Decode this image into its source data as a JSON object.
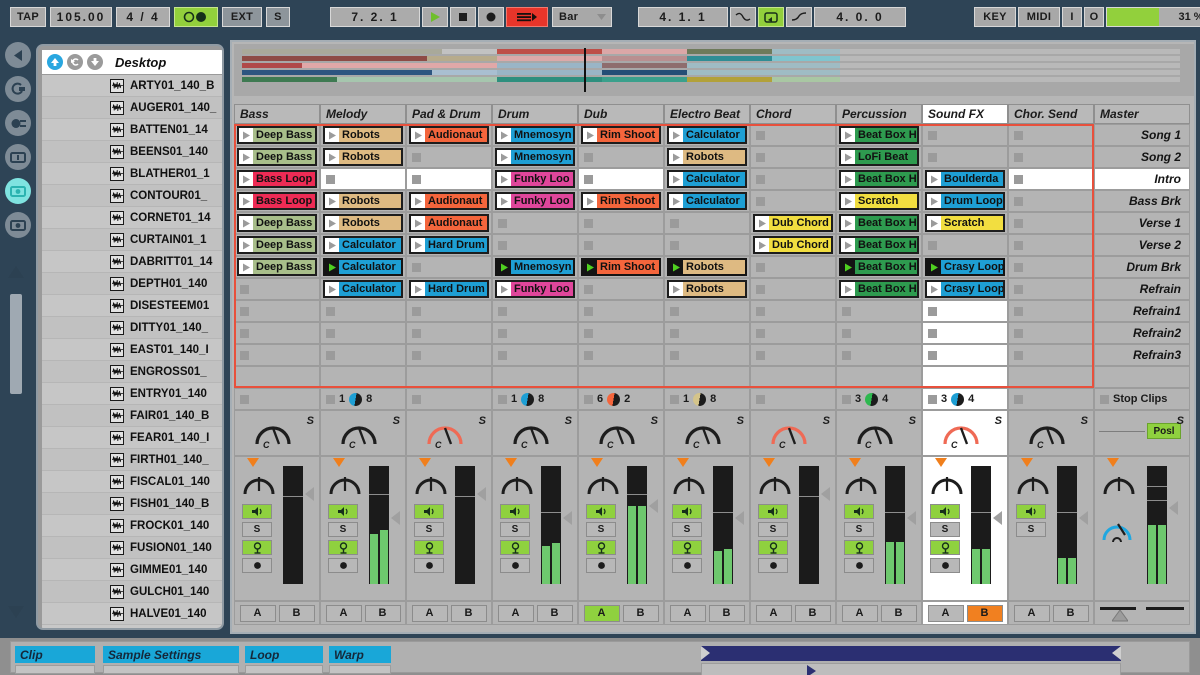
{
  "transport": {
    "tap_label": "TAP",
    "tempo": "105.00",
    "signature": "4 / 4",
    "metronome_icon": "metronome-icon",
    "ext_label": "EXT",
    "sync_label": "S",
    "position": "7. 2. 1",
    "play_icon": "play-icon",
    "stop_icon": "stop-icon",
    "record_icon": "record-icon",
    "follow_icon": "follow-icon",
    "quantization": "Bar",
    "loop_start": "4. 1. 1",
    "punch_in_icon": "punch-in-icon",
    "loop_icon": "loop-icon",
    "punch_out_icon": "punch-out-icon",
    "loop_length": "4. 0. 0",
    "key_label": "KEY",
    "midi_label": "MIDI",
    "in_label": "I",
    "out_label": "O",
    "cpu_load": "31 %"
  },
  "rail": {
    "items": [
      {
        "name": "back-icon"
      },
      {
        "name": "loop-browser-icon"
      },
      {
        "name": "plug-device-icon"
      },
      {
        "name": "clip-browser-icon"
      },
      {
        "name": "sample-browser-icon"
      },
      {
        "name": "file-browser-icon"
      }
    ]
  },
  "browser": {
    "up_icon": "up-arrow-icon",
    "back_icon": "back-arrow-icon",
    "down_icon": "down-arrow-icon",
    "title": "Desktop",
    "files": [
      "ARTY01_140_B",
      "AUGER01_140_",
      "BATTEN01_14",
      "BEENS01_140",
      "BLATHER01_1",
      "CONTOUR01_",
      "CORNET01_14",
      "CURTAIN01_1",
      "DABRITT01_14",
      "DEPTH01_140",
      "DISESTEEM01",
      "DITTY01_140_",
      "EAST01_140_I",
      "ENGROSS01_",
      "ENTRY01_140",
      "FAIR01_140_B",
      "FEAR01_140_I",
      "FIRTH01_140_",
      "FISCAL01_140",
      "FISH01_140_B",
      "FROCK01_140",
      "FUSION01_140",
      "GIMME01_140",
      "GULCH01_140",
      "HALVE01_140"
    ]
  },
  "session": {
    "tracks": [
      {
        "name": "Bass",
        "selected": false
      },
      {
        "name": "Melody",
        "selected": false
      },
      {
        "name": "Pad & Drum",
        "selected": false
      },
      {
        "name": "Drum",
        "selected": false
      },
      {
        "name": "Dub",
        "selected": false
      },
      {
        "name": "Electro Beat",
        "selected": false
      },
      {
        "name": "Chord",
        "selected": false
      },
      {
        "name": "Percussion",
        "selected": false
      },
      {
        "name": "Sound FX",
        "selected": true
      },
      {
        "name": "Chor. Send",
        "selected": false
      }
    ],
    "master_label": "Master",
    "scenes": [
      {
        "name": "Song 1",
        "selected": false
      },
      {
        "name": "Song 2",
        "selected": false
      },
      {
        "name": "Intro",
        "selected": true
      },
      {
        "name": "Bass Brk",
        "selected": false
      },
      {
        "name": "Verse 1",
        "selected": false
      },
      {
        "name": "Verse 2",
        "selected": false
      },
      {
        "name": "Drum Brk",
        "selected": false
      },
      {
        "name": "Refrain",
        "selected": false
      },
      {
        "name": "Refrain1",
        "selected": false
      },
      {
        "name": "Refrain2",
        "selected": false
      },
      {
        "name": "Refrain3",
        "selected": false
      },
      {
        "name": "",
        "selected": false
      }
    ],
    "clips": [
      [
        {
          "label": "Deep Bass",
          "color": "#a8be8a"
        },
        {
          "label": "Robots",
          "color": "#deba82"
        },
        {
          "label": "Audionaut",
          "color": "#f4653c"
        },
        {
          "label": "Mnemosyn",
          "color": "#1e9fd4"
        },
        {
          "label": "Rim Shoot",
          "color": "#f4653c"
        },
        {
          "label": "Calculator",
          "color": "#1e9fd4"
        },
        null,
        {
          "label": "Beat Box H",
          "color": "#2e9b4f"
        },
        null,
        null
      ],
      [
        {
          "label": "Deep Bass",
          "color": "#a8be8a"
        },
        {
          "label": "Robots",
          "color": "#deba82"
        },
        null,
        {
          "label": "Mnemosyn",
          "color": "#1e9fd4"
        },
        null,
        {
          "label": "Robots",
          "color": "#deba82"
        },
        null,
        {
          "label": "LoFi Beat",
          "color": "#2e9b4f"
        },
        null,
        null
      ],
      [
        {
          "label": "Bass Loop",
          "color": "#ee2b55"
        },
        {
          "label": "",
          "color": null,
          "empty_white": true
        },
        {
          "label": "",
          "color": null,
          "empty_white": true
        },
        {
          "label": "Funky Loo",
          "color": "#e0469b"
        },
        {
          "label": "",
          "color": null,
          "empty_white": true
        },
        {
          "label": "Calculator",
          "color": "#1e9fd4"
        },
        null,
        {
          "label": "Beat Box H",
          "color": "#2e9b4f"
        },
        {
          "label": "Boulderda",
          "color": "#1e9fd4"
        },
        {
          "label": "",
          "color": null,
          "empty_white": true
        }
      ],
      [
        {
          "label": "Bass Loop",
          "color": "#ee2b55"
        },
        {
          "label": "Robots",
          "color": "#deba82"
        },
        {
          "label": "Audionaut",
          "color": "#f4653c"
        },
        {
          "label": "Funky Loo",
          "color": "#e0469b"
        },
        {
          "label": "Rim Shoot",
          "color": "#f4653c"
        },
        {
          "label": "Calculator",
          "color": "#1e9fd4"
        },
        null,
        {
          "label": "Scratch",
          "color": "#f2de40"
        },
        {
          "label": "Drum Loop",
          "color": "#1e9fd4"
        },
        null
      ],
      [
        {
          "label": "Deep Bass",
          "color": "#a8be8a"
        },
        {
          "label": "Robots",
          "color": "#deba82"
        },
        {
          "label": "Audionaut",
          "color": "#f4653c"
        },
        null,
        null,
        null,
        {
          "label": "Dub Chord",
          "color": "#f2de40"
        },
        {
          "label": "Beat Box H",
          "color": "#2e9b4f"
        },
        {
          "label": "Scratch",
          "color": "#f2de40"
        },
        null
      ],
      [
        {
          "label": "Deep Bass",
          "color": "#a8be8a"
        },
        {
          "label": "Calculator",
          "color": "#1e9fd4"
        },
        {
          "label": "Hard Drum",
          "color": "#1e9fd4"
        },
        null,
        null,
        null,
        {
          "label": "Dub Chord",
          "color": "#f2de40"
        },
        {
          "label": "Beat Box H",
          "color": "#2e9b4f"
        },
        null,
        null
      ],
      [
        {
          "label": "Deep Bass",
          "color": "#a8be8a"
        },
        {
          "label": "Calculator",
          "color": "#1e9fd4",
          "playing": true
        },
        null,
        {
          "label": "Mnemosyn",
          "color": "#1e9fd4",
          "playing": true
        },
        {
          "label": "Rim Shoot",
          "color": "#f4653c",
          "playing": true
        },
        {
          "label": "Robots",
          "color": "#deba82",
          "playing": true
        },
        null,
        {
          "label": "Beat Box H",
          "color": "#2e9b4f",
          "playing": true
        },
        {
          "label": "Crasy Loop",
          "color": "#1e9fd4",
          "playing": true
        },
        null
      ],
      [
        null,
        {
          "label": "Calculator",
          "color": "#1e9fd4"
        },
        {
          "label": "Hard Drum",
          "color": "#1e9fd4"
        },
        {
          "label": "Funky Loo",
          "color": "#e0469b"
        },
        null,
        {
          "label": "Robots",
          "color": "#deba82"
        },
        null,
        {
          "label": "Beat Box H",
          "color": "#2e9b4f"
        },
        {
          "label": "Crasy Loop",
          "color": "#1e9fd4"
        },
        null
      ],
      [
        null,
        null,
        null,
        null,
        null,
        null,
        null,
        null,
        {
          "label": "",
          "color": null,
          "empty_white": true
        },
        null
      ],
      [
        null,
        null,
        null,
        null,
        null,
        null,
        null,
        null,
        {
          "label": "",
          "color": null,
          "empty_white": true
        },
        null
      ],
      [
        null,
        null,
        null,
        null,
        null,
        null,
        null,
        null,
        {
          "label": "",
          "color": null,
          "empty_white": true
        },
        null
      ],
      [
        {
          "blank": true
        },
        {
          "blank": true
        },
        {
          "blank": true
        },
        {
          "blank": true
        },
        {
          "blank": true
        },
        {
          "blank": true
        },
        {
          "blank": true
        },
        {
          "blank": true
        },
        {
          "blank": true,
          "empty_white": true
        },
        {
          "blank": true
        }
      ]
    ],
    "stop_row": [
      {
        "xfade": null
      },
      {
        "xfade": {
          "left": "1",
          "right": "8",
          "color": "#1e9fd4"
        }
      },
      {
        "xfade": null
      },
      {
        "xfade": {
          "left": "1",
          "right": "8",
          "color": "#1e9fd4"
        }
      },
      {
        "xfade": {
          "left": "6",
          "right": "2",
          "color": "#f4653c"
        }
      },
      {
        "xfade": {
          "left": "1",
          "right": "8",
          "color": "#d4c48a"
        }
      },
      {
        "xfade": null
      },
      {
        "xfade": {
          "left": "3",
          "right": "4",
          "color": "#2eb84f"
        }
      },
      {
        "xfade": {
          "left": "3",
          "right": "4",
          "color": "#1e9fd4"
        }
      },
      {
        "xfade": null
      }
    ],
    "stop_clips_label": "Stop Clips",
    "sends": [
      {
        "s_label": "S",
        "pan": "C",
        "active": false
      },
      {
        "s_label": "S",
        "pan": "C",
        "active": false
      },
      {
        "s_label": "S",
        "pan": "C",
        "active": true
      },
      {
        "s_label": "S",
        "pan": "C",
        "active": false
      },
      {
        "s_label": "S",
        "pan": "C",
        "active": false
      },
      {
        "s_label": "S",
        "pan": "C",
        "active": false
      },
      {
        "s_label": "S",
        "pan": "C",
        "active": true
      },
      {
        "s_label": "S",
        "pan": "C",
        "active": false
      },
      {
        "s_label": "S",
        "pan": "C",
        "active": true
      },
      {
        "s_label": "S",
        "pan": "C",
        "active": false
      }
    ],
    "master_send_label": "Posl",
    "master_s_label": "S",
    "mixer": [
      {
        "speaker": "on",
        "solo": "S",
        "arm": "on",
        "rec": "●",
        "meterL": 0,
        "meterR": 0,
        "ab": [
          "A",
          "B"
        ],
        "active_ab": null
      },
      {
        "speaker": "on",
        "solo": "S",
        "arm": "on",
        "rec": "●",
        "meterL": 42,
        "meterR": 46,
        "ab": [
          "A",
          "B"
        ],
        "active_ab": null
      },
      {
        "speaker": "on",
        "solo": "S",
        "arm": "on",
        "rec": "●",
        "meterL": 0,
        "meterR": 0,
        "ab": [
          "A",
          "B"
        ],
        "active_ab": null
      },
      {
        "speaker": "on",
        "solo": "S",
        "arm": "on",
        "rec": "●",
        "meterL": 32,
        "meterR": 35,
        "ab": [
          "A",
          "B"
        ],
        "active_ab": null
      },
      {
        "speaker": "on",
        "solo": "S",
        "arm": "on",
        "rec": "●",
        "meterL": 66,
        "meterR": 66,
        "ab": [
          "A",
          "B"
        ],
        "active_ab": "A"
      },
      {
        "speaker": "on",
        "solo": "S",
        "arm": "on",
        "rec": "●",
        "meterL": 28,
        "meterR": 30,
        "ab": [
          "A",
          "B"
        ],
        "active_ab": null
      },
      {
        "speaker": "on",
        "solo": "S",
        "arm": "on",
        "rec": "●",
        "meterL": 0,
        "meterR": 0,
        "ab": [
          "A",
          "B"
        ],
        "active_ab": null
      },
      {
        "speaker": "on",
        "solo": "S",
        "arm": "on",
        "rec": "●",
        "meterL": 36,
        "meterR": 36,
        "ab": [
          "A",
          "B"
        ],
        "active_ab": null
      },
      {
        "speaker": "on",
        "solo": "S",
        "arm": "on",
        "rec": "●",
        "meterL": 30,
        "meterR": 30,
        "ab": [
          "A",
          "B"
        ],
        "active_ab": "B"
      },
      {
        "speaker": "on",
        "solo": "S",
        "arm": null,
        "rec": null,
        "meterL": 22,
        "meterR": 22,
        "ab": [
          "A",
          "B"
        ],
        "active_ab": null
      }
    ],
    "master_mixer": {
      "meterL": 50,
      "meterR": 50,
      "cue_icon": "headphone-icon",
      "crossfader_icon": "crossfader-icon"
    }
  },
  "bottom": {
    "tabs": [
      "Clip",
      "Sample Settings",
      "Loop",
      "Warp"
    ],
    "loop_icon": "loop-brace-icon",
    "play_marker_icon": "play-marker-icon"
  },
  "colors": {
    "accent_blue": "#19a7d8",
    "green": "#92d03c",
    "red": "#e8352a",
    "orange": "#f18020",
    "selection": "#e8503c",
    "chrome": "#2e4456"
  }
}
